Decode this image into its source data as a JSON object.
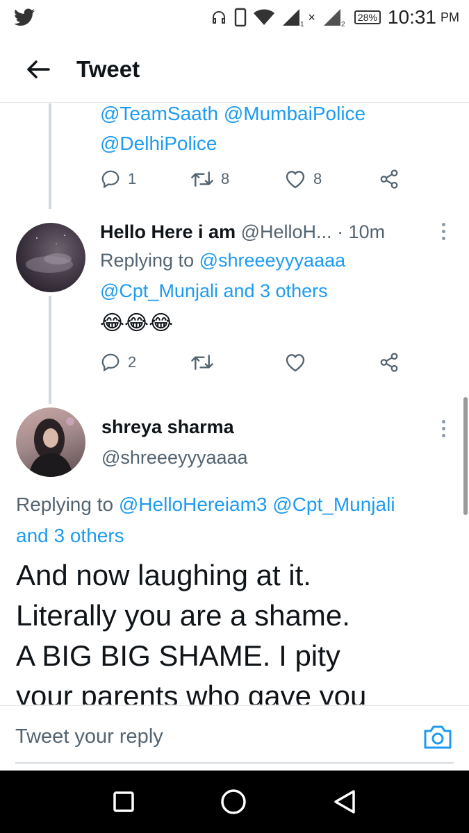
{
  "status_bar": {
    "battery": "28%",
    "time": "10:31",
    "ampm": "PM",
    "sim1_label": "1",
    "sim2_label": "2"
  },
  "header": {
    "title": "Tweet"
  },
  "tweet_prev": {
    "mentions_line1": "@TeamSaath @MumbaiPolice",
    "mentions_line2": "@DelhiPolice",
    "reply_count": "1",
    "retweet_count": "8",
    "like_count": "8"
  },
  "tweet_reply": {
    "display_name": "Hello Here i am",
    "handle": "@HelloH...",
    "time": "· 10m",
    "replying_prefix": "Replying to ",
    "replying_mention1": "@shreeeyyyaaaa",
    "replying_line2": "@Cpt_Munjali and 3 others",
    "emoji": "😂😂😂",
    "reply_count": "2"
  },
  "tweet_main": {
    "display_name": "shreya sharma",
    "handle": "@shreeeyyyaaaa",
    "replying_prefix": "Replying to ",
    "replying_mentions": "@HelloHereiam3 @Cpt_Munjali",
    "replying_others": "and 3 others",
    "text_line1": "And now laughing at it.",
    "text_line2": "Literally you are a shame.",
    "text_line3": "A BIG BIG SHAME. I pity",
    "text_line4": "your parents who gave you"
  },
  "reply_bar": {
    "placeholder": "Tweet your reply"
  },
  "colors": {
    "accent": "#1d9bf0",
    "muted": "#536471"
  },
  "icons": [
    "twitter-bird-icon",
    "back-arrow-icon",
    "reply-icon",
    "retweet-icon",
    "like-icon",
    "share-icon",
    "more-icon",
    "camera-icon",
    "recent-apps-icon",
    "home-icon",
    "back-icon"
  ]
}
